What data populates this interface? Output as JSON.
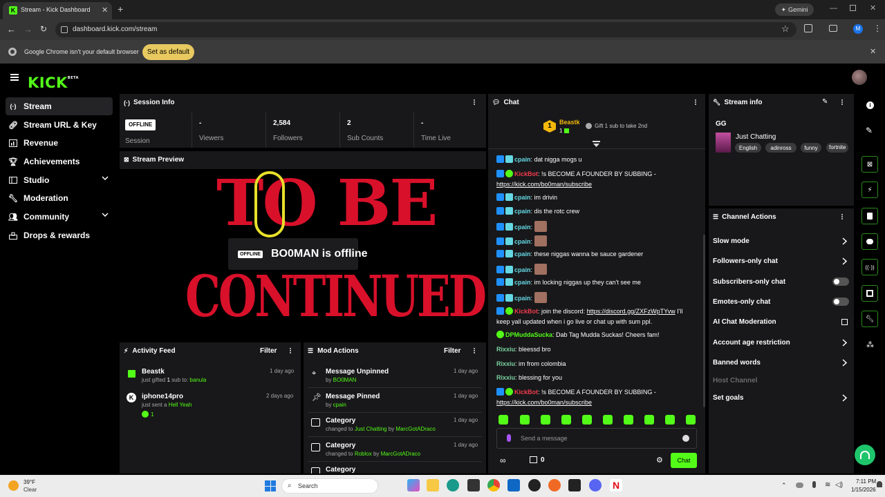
{
  "browser": {
    "tab_title": "Stream - Kick Dashboard",
    "url": "dashboard.kick.com/stream",
    "gemini_label": "Gemini",
    "profile_initial": "M",
    "infobar_message": "Google Chrome isn't your default browser",
    "set_default_label": "Set as default"
  },
  "logo": {
    "text": "KICK",
    "beta": "BETA"
  },
  "sidebar": {
    "items": [
      {
        "label": "Stream",
        "icon": "stream-icon"
      },
      {
        "label": "Stream URL & Key",
        "icon": "link-icon"
      },
      {
        "label": "Revenue",
        "icon": "revenue-icon"
      },
      {
        "label": "Achievements",
        "icon": "trophy-icon"
      },
      {
        "label": "Studio",
        "icon": "studio-icon"
      },
      {
        "label": "Moderation",
        "icon": "wrench-icon"
      },
      {
        "label": "Community",
        "icon": "community-icon"
      },
      {
        "label": "Drops & rewards",
        "icon": "drops-icon"
      }
    ]
  },
  "session": {
    "title": "Session Info",
    "status": "OFFLINE",
    "status_label": "Session",
    "viewers_value": "-",
    "viewers_label": "Viewers",
    "followers_value": "2,584",
    "followers_label": "Followers",
    "subs_value": "2",
    "subs_label": "Sub Counts",
    "time_value": "-",
    "time_label": "Time Live"
  },
  "preview": {
    "title": "Stream Preview",
    "offline_badge": "OFFLINE",
    "offline_text": "BO0MAN is offline",
    "art_top": "TO BE",
    "art_bottom": "CONTINUED"
  },
  "activity": {
    "title": "Activity Feed",
    "filter_label": "Filter",
    "items": [
      {
        "user": "Beastk",
        "pre": "just gifted ",
        "num": "1",
        "mid": " sub to: ",
        "target": "banula",
        "time": "1 day ago"
      },
      {
        "user": "iphone14pro",
        "pre": "just sent a ",
        "target": "Hell Yeah",
        "kicks": "1",
        "time": "2 days ago"
      }
    ]
  },
  "mod": {
    "title": "Mod Actions",
    "filter_label": "Filter",
    "items": [
      {
        "title": "Message Unpinned",
        "by_label": "by ",
        "by": "BO0MAN",
        "time": "1 day ago"
      },
      {
        "title": "Message Pinned",
        "by_label": "by ",
        "by": "cpain",
        "time": "1 day ago"
      },
      {
        "title": "Category",
        "pre": "changed to ",
        "value": "Just Chatting",
        "by_label": " by ",
        "by": "MarcGotADraco",
        "time": "1 day ago"
      },
      {
        "title": "Category",
        "pre": "changed to ",
        "value": "Roblox",
        "by_label": " by ",
        "by": "MarcGotADraco",
        "time": "1 day ago"
      },
      {
        "title": "Category"
      }
    ]
  },
  "chat": {
    "title": "Chat",
    "top_gifter_rank": "1",
    "top_gifter_name": "Beastk",
    "top_gifter_count": "1",
    "gift_prompt": "Gift 1 sub to take 2nd",
    "messages": [
      {
        "user": "cpain",
        "text": "dat nigga mogs u"
      },
      {
        "user": "KickBot",
        "text": "!s BECOME A FOUNDER BY SUBBING -",
        "link": "https://kick.com/bo0man/subscribe"
      },
      {
        "user": "cpain",
        "text": "im drivin"
      },
      {
        "user": "cpain",
        "text": "dis the rotc crew"
      },
      {
        "user": "cpain",
        "text": ""
      },
      {
        "user": "cpain",
        "text": ""
      },
      {
        "user": "cpain",
        "text": "these niggas wanna be sauce gardener"
      },
      {
        "user": "cpain",
        "text": ""
      },
      {
        "user": "cpain",
        "text": "im locking niggas up they can't see me"
      },
      {
        "user": "cpain",
        "text": ""
      },
      {
        "user": "KickBot",
        "text": "join the discord: ",
        "link": "https://discord.gg/ZXFzWpTYvw",
        "after": " I'll keep yall updated when i go live or chat up with sum ppl."
      },
      {
        "user": "DPMuddaSucka",
        "text": "Dab Tag Mudda Suckas! Cheers fam!"
      },
      {
        "user": "Rixxiu",
        "text": "bleessd bro"
      },
      {
        "user": "Rixxiu",
        "text": "im from colombia"
      },
      {
        "user": "Rixxiu",
        "text": "blessing for you"
      },
      {
        "user": "KickBot",
        "text": "!s BECOME A FOUNDER BY SUBBING -",
        "link": "https://kick.com/bo0man/subscribe"
      }
    ],
    "input_placeholder": "Send a message",
    "kicks_count": "0",
    "send_label": "Chat"
  },
  "stream_info": {
    "title": "Stream info",
    "stream_title": "GG",
    "category": "Just Chatting",
    "tags": [
      "English",
      "adinross",
      "funny",
      "fortnite"
    ]
  },
  "channel_actions": {
    "title": "Channel Actions",
    "items": [
      {
        "label": "Slow mode",
        "control": "chevron"
      },
      {
        "label": "Followers-only chat",
        "control": "chevron"
      },
      {
        "label": "Subscribers-only chat",
        "control": "toggle-off"
      },
      {
        "label": "Emotes-only chat",
        "control": "toggle-off"
      },
      {
        "label": "AI Chat Moderation",
        "control": "external"
      },
      {
        "label": "Account age restriction",
        "control": "chevron"
      },
      {
        "label": "Banned words",
        "control": "chevron"
      },
      {
        "label": "Host Channel",
        "control": "disabled"
      },
      {
        "label": "Set goals",
        "control": "chevron"
      }
    ]
  },
  "taskbar": {
    "weather_temp": "39°F",
    "weather_desc": "Clear",
    "search_placeholder": "Search",
    "time": "7:11 PM",
    "date": "1/15/2026"
  },
  "colors": {
    "accent": "#53fc18",
    "panel": "#18181a",
    "chrome": "#353535",
    "infobar_button": "#e8c960"
  }
}
